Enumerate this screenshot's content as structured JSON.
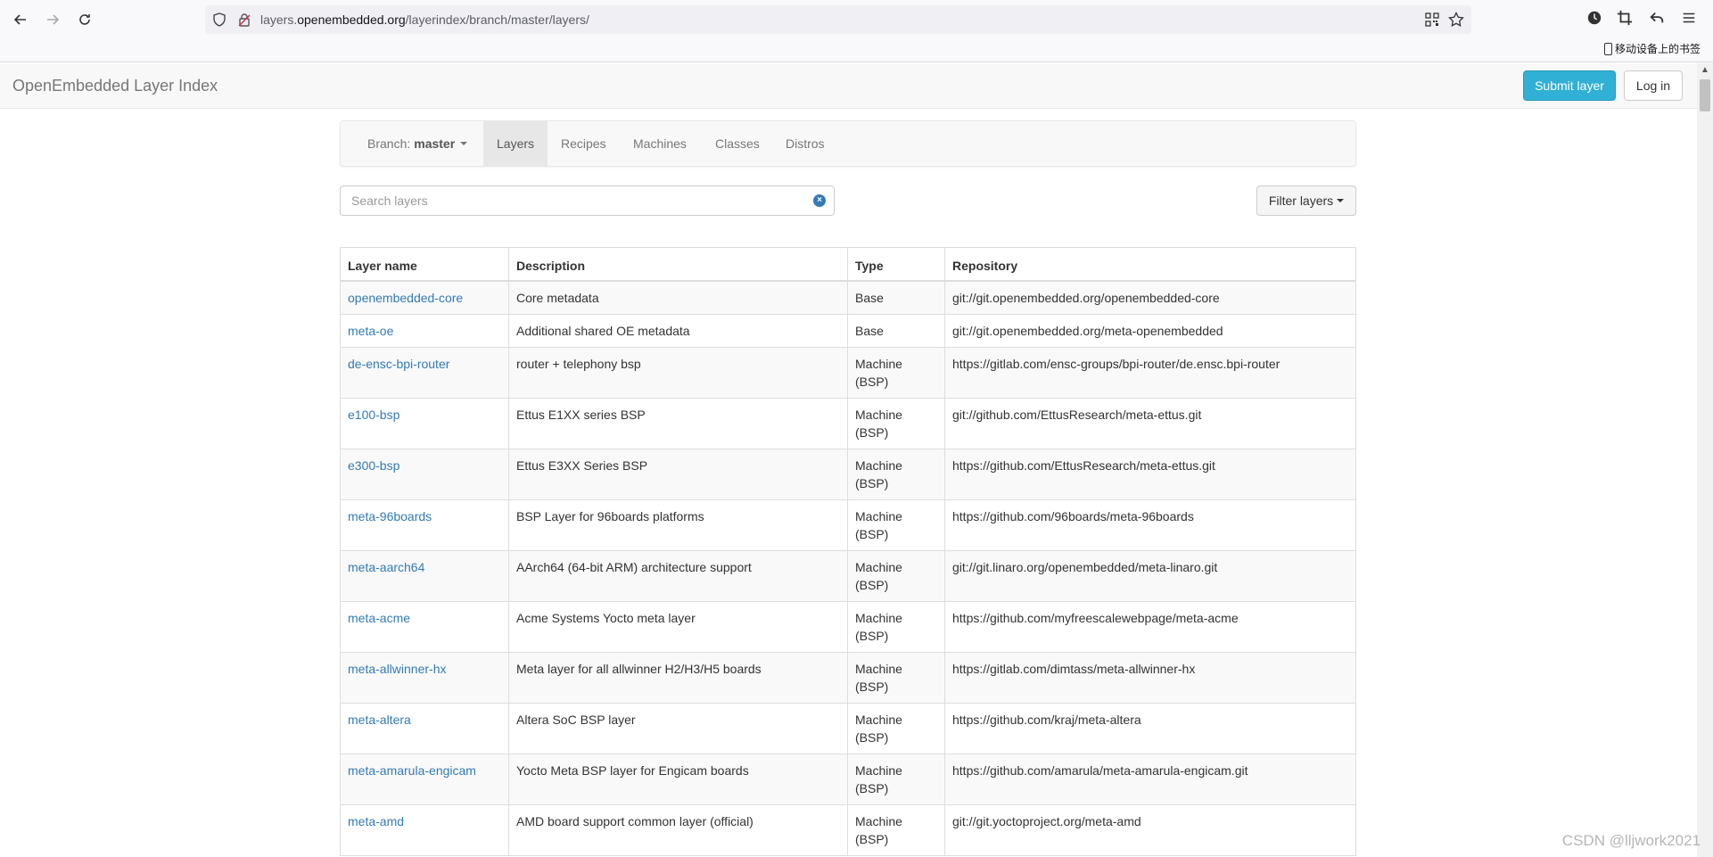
{
  "browser": {
    "url_prefix": "layers.",
    "url_domain": "openembedded.org",
    "url_path": "/layerindex/branch/master/layers/",
    "bookmark_label": "移动设备上的书签"
  },
  "navbar": {
    "brand": "OpenEmbedded Layer Index",
    "submit_label": "Submit layer",
    "login_label": "Log in"
  },
  "subnav": {
    "branch_label": "Branch:",
    "branch_value": "master",
    "tabs": [
      {
        "label": "Layers"
      },
      {
        "label": "Recipes"
      },
      {
        "label": "Machines"
      },
      {
        "label": "Classes"
      },
      {
        "label": "Distros"
      }
    ]
  },
  "search": {
    "placeholder": "Search layers",
    "filter_label": "Filter layers"
  },
  "table": {
    "headers": [
      "Layer name",
      "Description",
      "Type",
      "Repository"
    ],
    "rows": [
      {
        "name": "openembedded-core",
        "description": "Core metadata",
        "type": "Base",
        "repo": "git://git.openembedded.org/openembedded-core"
      },
      {
        "name": "meta-oe",
        "description": "Additional shared OE metadata",
        "type": "Base",
        "repo": "git://git.openembedded.org/meta-openembedded"
      },
      {
        "name": "de-ensc-bpi-router",
        "description": "router + telephony bsp",
        "type": "Machine (BSP)",
        "repo": "https://gitlab.com/ensc-groups/bpi-router/de.ensc.bpi-router"
      },
      {
        "name": "e100-bsp",
        "description": "Ettus E1XX series BSP",
        "type": "Machine (BSP)",
        "repo": "git://github.com/EttusResearch/meta-ettus.git"
      },
      {
        "name": "e300-bsp",
        "description": "Ettus E3XX Series BSP",
        "type": "Machine (BSP)",
        "repo": "https://github.com/EttusResearch/meta-ettus.git"
      },
      {
        "name": "meta-96boards",
        "description": "BSP Layer for 96boards platforms",
        "type": "Machine (BSP)",
        "repo": "https://github.com/96boards/meta-96boards"
      },
      {
        "name": "meta-aarch64",
        "description": "AArch64 (64-bit ARM) architecture support",
        "type": "Machine (BSP)",
        "repo": "git://git.linaro.org/openembedded/meta-linaro.git"
      },
      {
        "name": "meta-acme",
        "description": "Acme Systems Yocto meta layer",
        "type": "Machine (BSP)",
        "repo": "https://github.com/myfreescalewebpage/meta-acme"
      },
      {
        "name": "meta-allwinner-hx",
        "description": "Meta layer for all allwinner H2/H3/H5 boards",
        "type": "Machine (BSP)",
        "repo": "https://gitlab.com/dimtass/meta-allwinner-hx"
      },
      {
        "name": "meta-altera",
        "description": "Altera SoC BSP layer",
        "type": "Machine (BSP)",
        "repo": "https://github.com/kraj/meta-altera"
      },
      {
        "name": "meta-amarula-engicam",
        "description": "Yocto Meta BSP layer for Engicam boards",
        "type": "Machine (BSP)",
        "repo": "https://github.com/amarula/meta-amarula-engicam.git"
      },
      {
        "name": "meta-amd",
        "description": "AMD board support common layer (official)",
        "type": "Machine (BSP)",
        "repo": "git://git.yoctoproject.org/meta-amd"
      }
    ]
  },
  "watermark": "CSDN @lljwork2021"
}
